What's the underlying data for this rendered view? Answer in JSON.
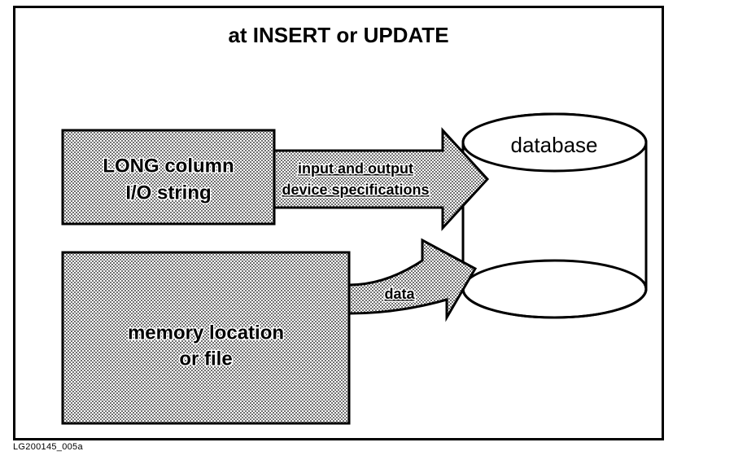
{
  "title": "at INSERT or UPDATE",
  "figure_id": "LG200145_005a",
  "boxes": {
    "long_column": {
      "line1": "LONG column",
      "line2": "I/O string"
    },
    "memory": {
      "line1": "memory location",
      "line2": "or file"
    }
  },
  "database_label": "database",
  "arrows": {
    "spec": {
      "line1": "input and output",
      "line2": "device specifications"
    },
    "data": "data"
  }
}
